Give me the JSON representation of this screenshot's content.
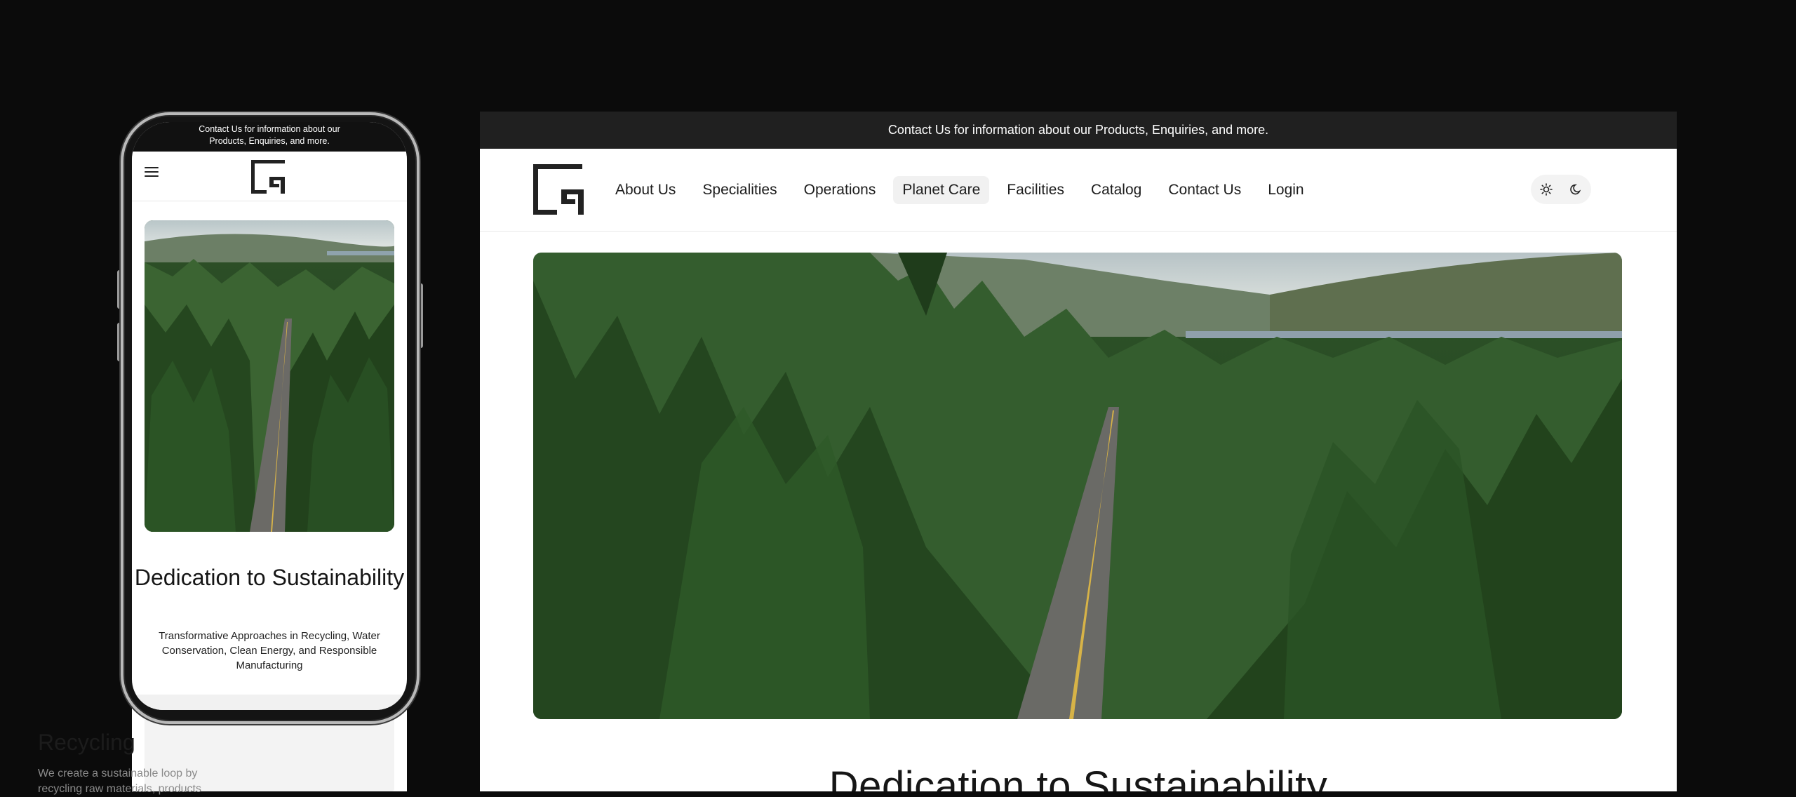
{
  "mobile": {
    "topbar_text": "Contact Us for information about our Products, Enquiries, and more.",
    "menu_icon": "hamburger-menu-icon",
    "hero_image": "forest-road-aerial-photo",
    "title": "Dedication to Sustainability",
    "subtitle": "Transformative Approaches in Recycling, Water Conservation, Clean Energy, and Responsible Manufacturing",
    "card": {
      "title": "Recycling",
      "text": "We create a sustainable loop by recycling raw materials, products"
    }
  },
  "desktop": {
    "topbar_text": "Contact Us for information about our Products, Enquiries, and more.",
    "nav": {
      "items": [
        {
          "label": "About Us"
        },
        {
          "label": "Specialities"
        },
        {
          "label": "Operations"
        },
        {
          "label": "Planet Care",
          "active": true
        },
        {
          "label": "Facilities"
        },
        {
          "label": "Catalog"
        },
        {
          "label": "Contact Us"
        },
        {
          "label": "Login"
        }
      ]
    },
    "theme_toggle": {
      "light_icon": "sun-icon",
      "dark_icon": "moon-icon"
    },
    "hero_image": "forest-road-aerial-photo",
    "title": "Dedication to Sustainability"
  },
  "colors": {
    "background": "#0b0b0b",
    "topbar": "#202020",
    "forest_dark": "#1f3a1d",
    "forest_mid": "#2f5a2a",
    "active_nav_bg": "#f1f1f1"
  }
}
